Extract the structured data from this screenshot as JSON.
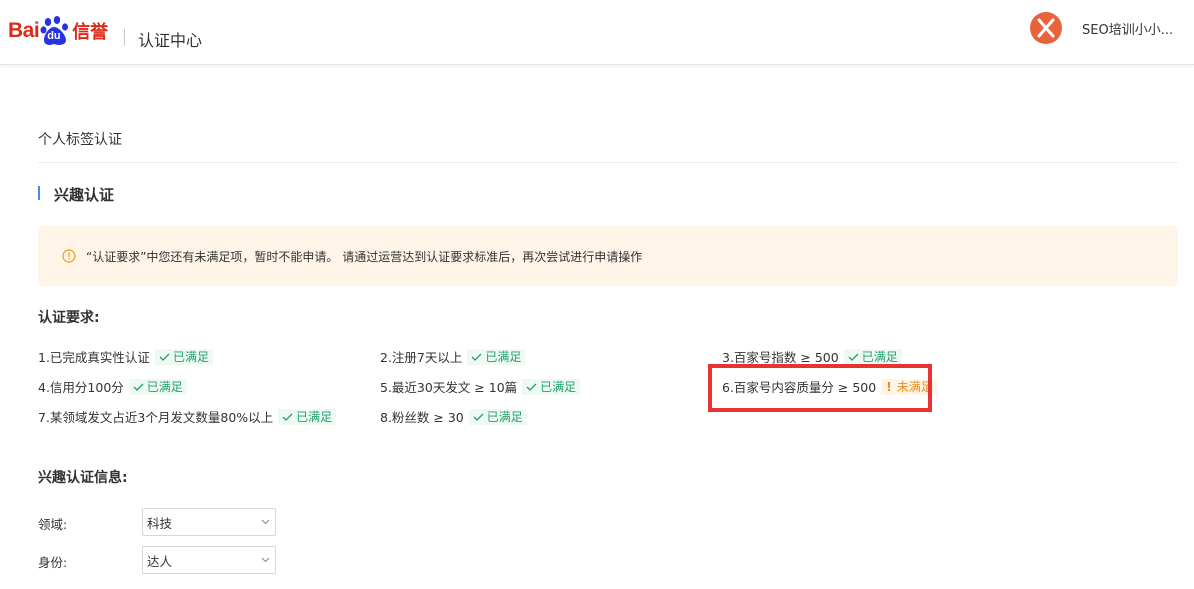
{
  "header": {
    "logo_bai": "Bai",
    "logo_du": "du",
    "logo_xin": "信誉",
    "title": "认证中心",
    "username": "SEO培训小小..."
  },
  "page": {
    "subtitle": "个人标签认证",
    "section_title": "兴趣认证"
  },
  "notice": {
    "text": "“认证要求”中您还有未满足项，暂时不能申请。 请通过运营达到认证要求标准后，再次尝试进行申请操作"
  },
  "requirements": {
    "title": "认证要求:",
    "items": [
      {
        "label": "1.已完成真实性认证",
        "status": "已满足",
        "met": true
      },
      {
        "label": "2.注册7天以上",
        "status": "已满足",
        "met": true
      },
      {
        "label": "3.百家号指数 ≥ 500",
        "status": "已满足",
        "met": true
      },
      {
        "label": "4.信用分100分",
        "status": "已满足",
        "met": true
      },
      {
        "label": "5.最近30天发文 ≥ 10篇",
        "status": "已满足",
        "met": true
      },
      {
        "label": "6.百家号内容质量分 ≥ 500",
        "status": "未满足",
        "met": false
      },
      {
        "label": "7.某领域发文占近3个月发文数量80%以上",
        "status": "已满足",
        "met": true
      },
      {
        "label": "8.粉丝数 ≥ 30",
        "status": "已满足",
        "met": true
      }
    ]
  },
  "info": {
    "title": "兴趣认证信息:",
    "domain_label": "领域:",
    "domain_value": "科技",
    "identity_label": "身份:",
    "identity_value": "达人"
  },
  "colors": {
    "brand_red": "#de2a18",
    "brand_blue": "#2932e1",
    "ok_green": "#22a06b",
    "warn_orange": "#ee8b16",
    "highlight_red": "#e83333"
  }
}
